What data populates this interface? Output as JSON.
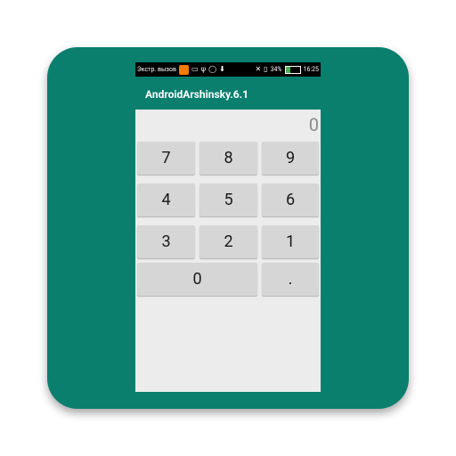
{
  "statusbar": {
    "notification_text": "Экстр. вызов",
    "battery_percent": "34%",
    "battery_level": 0.34,
    "time": "16:25",
    "icons": [
      "notification-app-icon",
      "image-icon",
      "usb-icon",
      "whatsapp-icon",
      "download-icon",
      "silent-icon",
      "sim-icon",
      "battery-icon"
    ]
  },
  "app": {
    "title": "AndroidArshinsky.6.1"
  },
  "calculator": {
    "display_value": "0",
    "keys": {
      "k7": "7",
      "k8": "8",
      "k9": "9",
      "k4": "4",
      "k5": "5",
      "k6": "6",
      "k3": "3",
      "k2": "2",
      "k1": "1",
      "k0": "0",
      "kdot": "."
    }
  },
  "colors": {
    "tile": "#0a7f6e",
    "appbar": "#0a7f6e",
    "key": "#d6d6d6",
    "content": "#ececec"
  }
}
